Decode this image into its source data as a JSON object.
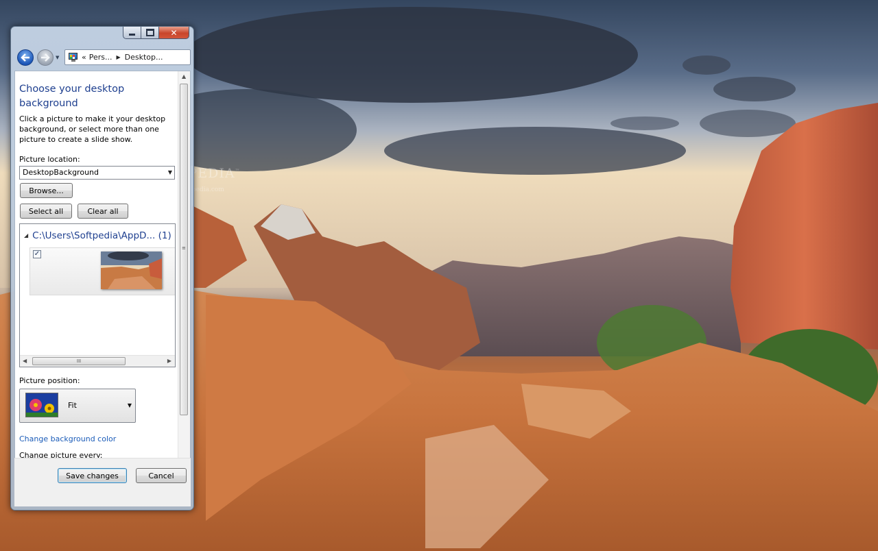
{
  "window": {
    "caption_buttons": {
      "minimize": "minimize",
      "maximize": "maximize",
      "close": "✕"
    },
    "breadcrumb": {
      "overflow": "«",
      "items": [
        "Pers...",
        "Desktop..."
      ]
    }
  },
  "content": {
    "title": "Choose your desktop background",
    "description": "Click a picture to make it your desktop background, or select more than one picture to create a slide show.",
    "picture_location_label": "Picture location:",
    "picture_location_value": "DesktopBackground",
    "browse_label": "Browse...",
    "select_all_label": "Select all",
    "clear_all_label": "Clear all",
    "picture_group": {
      "path": "C:\\Users\\Softpedia\\AppD...",
      "count": "(1)"
    },
    "thumbnail": {
      "checked": true,
      "check_glyph": "✓"
    },
    "hscroll_grip": "III",
    "picture_position_label": "Picture position:",
    "picture_position_value": "Fit",
    "change_bg_color_link": "Change background color",
    "change_picture_every_label": "Change picture every:"
  },
  "footer": {
    "save_label": "Save changes",
    "cancel_label": "Cancel"
  },
  "desktop": {
    "watermark": "SOFTPEDIA",
    "watermark_tm": "™",
    "watermark_url": "www.softpedia.com"
  },
  "colors": {
    "link": "#1a5bb8",
    "heading": "#1e3f8f",
    "close_button": "#c8452b"
  }
}
